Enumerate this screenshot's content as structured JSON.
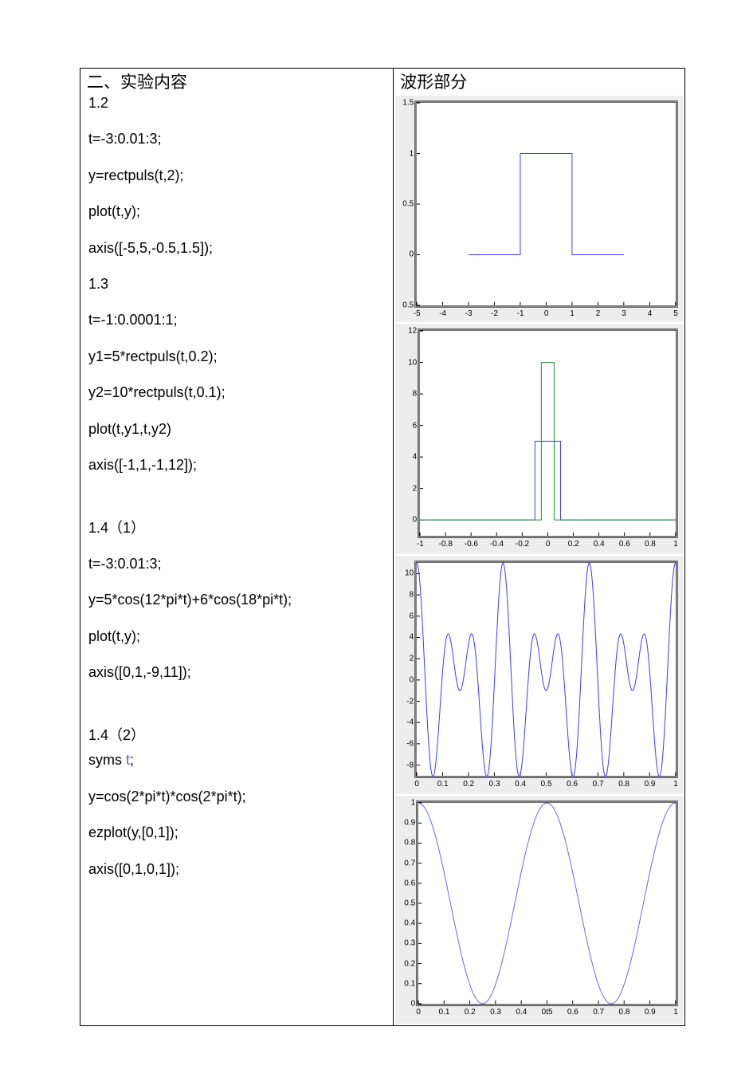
{
  "layout": {
    "left_header": "二、实验内容",
    "right_header": "波形部分"
  },
  "code": {
    "s12": "1.2",
    "s12_l1": "t=-3:0.01:3;",
    "s12_l2": "y=rectpuls(t,2);",
    "s12_l3": "plot(t,y);",
    "s12_l4": "axis([-5,5,-0.5,1.5]);",
    "s13": "1.3",
    "s13_l1": "t=-1:0.0001:1;",
    "s13_l2": "y1=5*rectpuls(t,0.2);",
    "s13_l3": "y2=10*rectpuls(t,0.1);",
    "s13_l4": "plot(t,y1,t,y2)",
    "s13_l5": "axis([-1,1,-1,12]);",
    "s14a": "1.4（1）",
    "s14a_l1": "t=-3:0.01:3;",
    "s14a_l2": "y=5*cos(12*pi*t)+6*cos(18*pi*t);",
    "s14a_l3": "plot(t,y);",
    "s14a_l4": "axis([0,1,-9,11]);",
    "s14b": "1.4（2）",
    "s14b_pre": "syms  ",
    "s14b_t": "t",
    "s14b_post": ";",
    "s14b_l2": "y=cos(2*pi*t)*cos(2*pi*t);",
    "s14b_l3": "ezplot(y,[0,1]);",
    "s14b_l4": "axis([0,1,0,1]);"
  },
  "chart_data": [
    {
      "type": "line",
      "title": "",
      "xlabel": "",
      "ylabel": "",
      "xlim": [
        -5,
        5
      ],
      "ylim": [
        -0.5,
        1.5
      ],
      "xticks": [
        -5,
        -4,
        -3,
        -2,
        -1,
        0,
        1,
        2,
        3,
        4,
        5
      ],
      "yticks": [
        0.5,
        0,
        0.5,
        1,
        1.5
      ],
      "ytick_labels": [
        "0.5",
        "0",
        "0.5",
        "1",
        "1.5"
      ],
      "series": [
        {
          "name": "rectpuls(t,2)",
          "color": "#3b3bff",
          "x": [
            -3,
            -1,
            -1,
            1,
            1,
            3
          ],
          "y": [
            0,
            0,
            1,
            1,
            0,
            0
          ]
        }
      ]
    },
    {
      "type": "line",
      "title": "",
      "xlabel": "",
      "ylabel": "",
      "xlim": [
        -1,
        1
      ],
      "ylim": [
        -1,
        12
      ],
      "xticks": [
        -1,
        -0.8,
        -0.6,
        -0.4,
        -0.2,
        0,
        0.2,
        0.4,
        0.6,
        0.8,
        1
      ],
      "yticks": [
        0,
        2,
        4,
        6,
        8,
        10,
        12
      ],
      "series": [
        {
          "name": "5*rectpuls(t,0.2)",
          "color": "#3b3bff",
          "x": [
            -1,
            -0.1,
            -0.1,
            0.1,
            0.1,
            1
          ],
          "y": [
            0,
            0,
            5,
            5,
            0,
            0
          ]
        },
        {
          "name": "10*rectpuls(t,0.1)",
          "color": "#2a8a2a",
          "x": [
            -1,
            -0.05,
            -0.05,
            0.05,
            0.05,
            1
          ],
          "y": [
            0,
            0,
            10,
            10,
            0,
            0
          ]
        }
      ]
    },
    {
      "type": "line",
      "title": "",
      "xlabel": "",
      "ylabel": "",
      "xlim": [
        0,
        1
      ],
      "ylim": [
        -9,
        11
      ],
      "xticks": [
        0,
        0.1,
        0.2,
        0.3,
        0.4,
        0.5,
        0.6,
        0.7,
        0.8,
        0.9,
        1
      ],
      "yticks": [
        -8,
        -6,
        -4,
        -2,
        0,
        2,
        4,
        6,
        8,
        10
      ],
      "series": [
        {
          "name": "5cos(12πt)+6cos(18πt)",
          "color": "#3b3bff",
          "formula": "5*cos(12*pi*t)+6*cos(18*pi*t)"
        }
      ]
    },
    {
      "type": "line",
      "title": "",
      "xlabel": "t",
      "ylabel": "",
      "xlim": [
        0,
        1
      ],
      "ylim": [
        0,
        1
      ],
      "xticks": [
        0,
        0.1,
        0.2,
        0.3,
        0.4,
        0.5,
        0.6,
        0.7,
        0.8,
        0.9,
        1
      ],
      "yticks": [
        0,
        0.1,
        0.2,
        0.3,
        0.4,
        0.5,
        0.6,
        0.7,
        0.8,
        0.9,
        1
      ],
      "series": [
        {
          "name": "cos(2πt)^2",
          "color": "#6a6ad8",
          "formula": "cos(2*pi*t)^2"
        }
      ]
    }
  ]
}
